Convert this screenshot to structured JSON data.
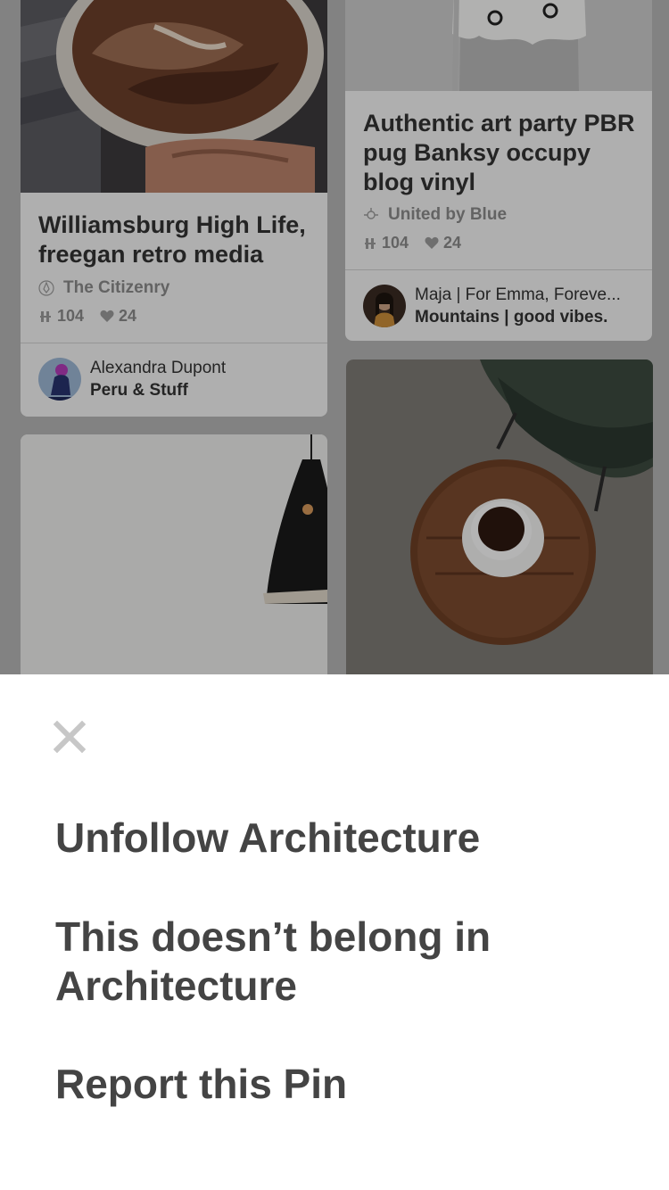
{
  "pins": [
    {
      "title": "Williamsburg High Life, freegan retro media",
      "source": "The Citizenry",
      "repins": "104",
      "likes": "24",
      "user_name": "Alexandra Dupont",
      "board_name": "Peru & Stuff"
    },
    {
      "title": "Authentic art party PBR pug Banksy occupy blog vinyl",
      "source": "United by Blue",
      "repins": "104",
      "likes": "24",
      "user_name": "Maja | For Emma, Foreve...",
      "board_name": "Mountains | good vibes."
    }
  ],
  "menu": {
    "close_icon": "close-icon",
    "items": [
      "Unfollow Architecture",
      "This doesn’t belong in Architecture",
      "Report this Pin"
    ]
  },
  "colors": {
    "menu_text": "#444444",
    "card_bg": "#f3f3f3",
    "meta_text": "#8a8a8a"
  }
}
